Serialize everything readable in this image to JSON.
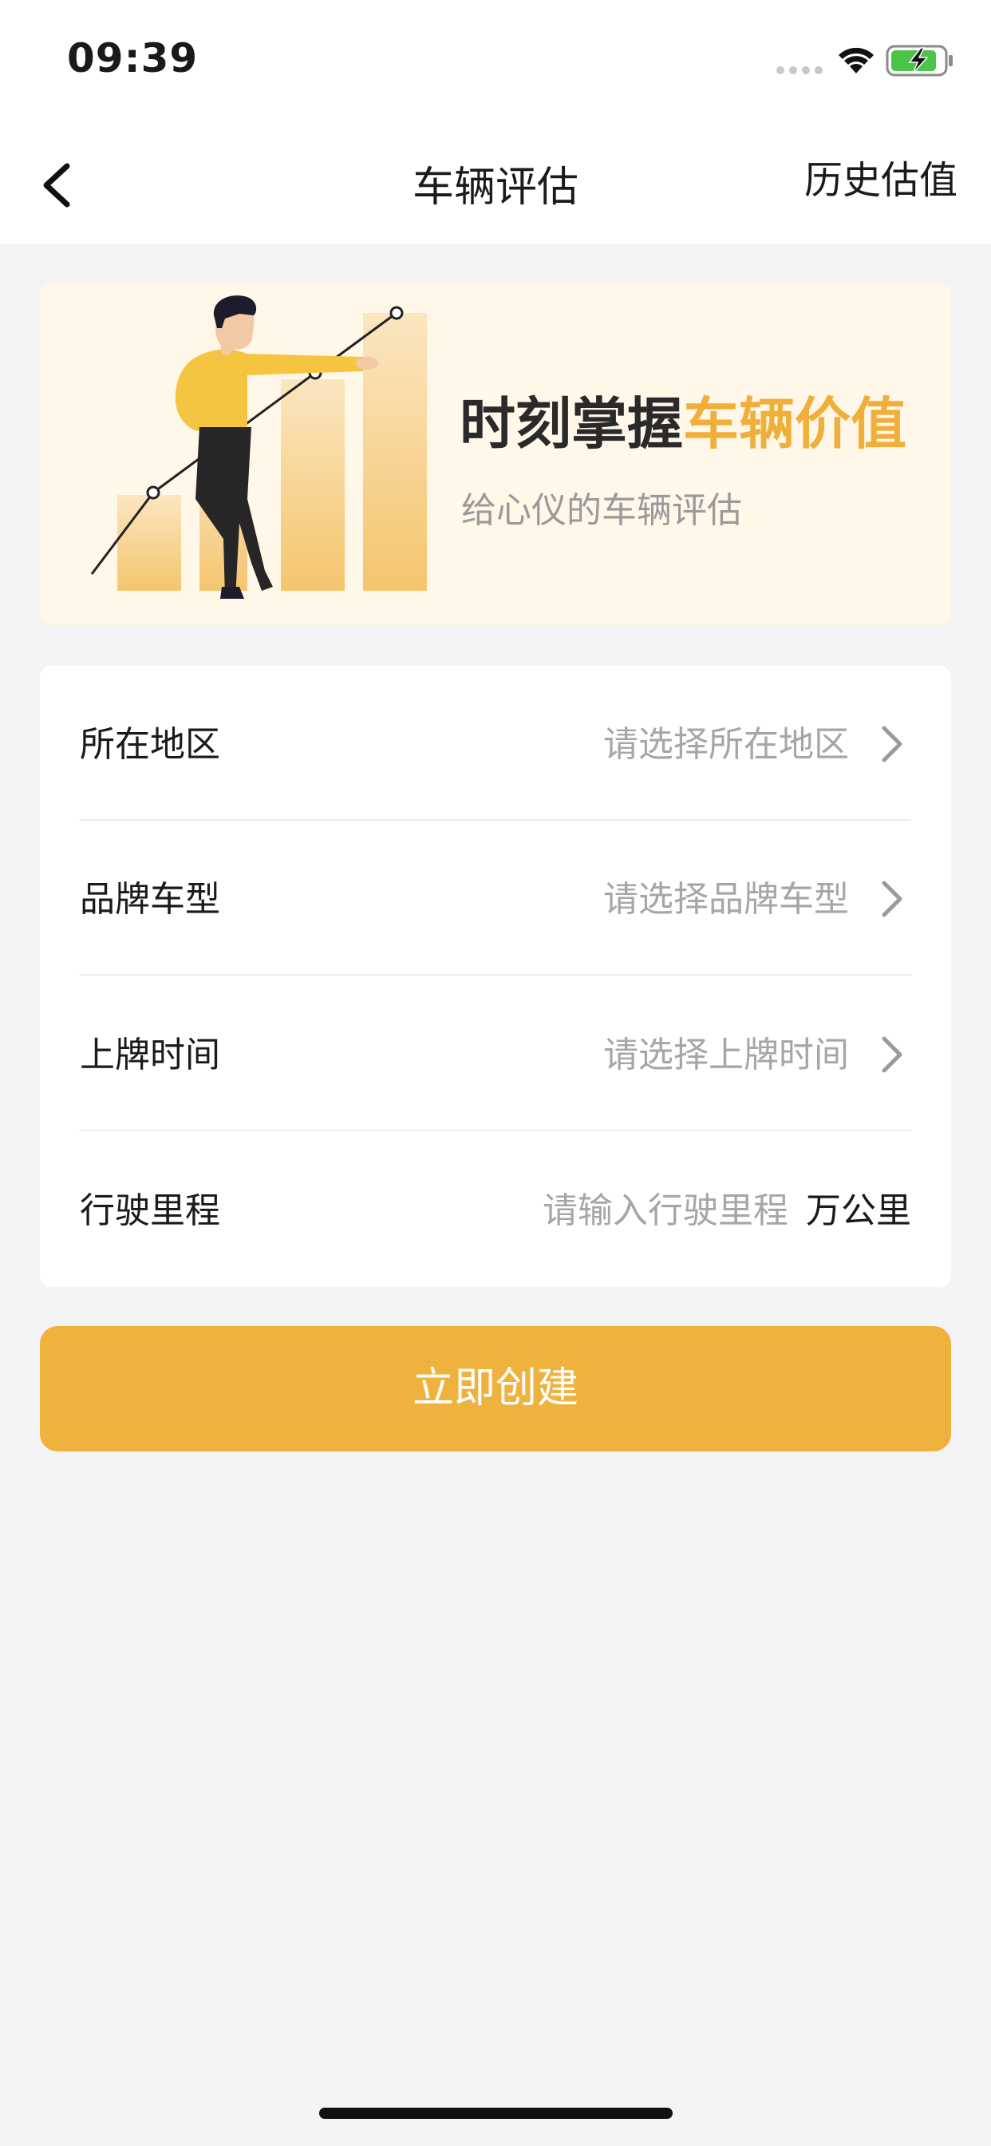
{
  "status_bar": {
    "time": "09:39"
  },
  "nav": {
    "title": "车辆评估",
    "right_action": "历史估值"
  },
  "banner": {
    "title_prefix": "时刻掌握",
    "title_highlight": "车辆价值",
    "subtitle": "给心仪的车辆评估"
  },
  "form": {
    "rows": [
      {
        "label": "所在地区",
        "placeholder": "请选择所在地区",
        "icon": "chevron-right-icon"
      },
      {
        "label": "品牌车型",
        "placeholder": "请选择品牌车型",
        "icon": "chevron-right-icon"
      },
      {
        "label": "上牌时间",
        "placeholder": "请选择上牌时间",
        "icon": "chevron-right-icon"
      },
      {
        "label": "行驶里程",
        "placeholder": "请输入行驶里程",
        "unit": "万公里"
      }
    ]
  },
  "submit": {
    "label": "立即创建"
  },
  "colors": {
    "accent": "#f0b23e",
    "banner_bg": "#fff7e8",
    "page_bg": "#f4f4f6",
    "placeholder": "#a6a6a6"
  }
}
